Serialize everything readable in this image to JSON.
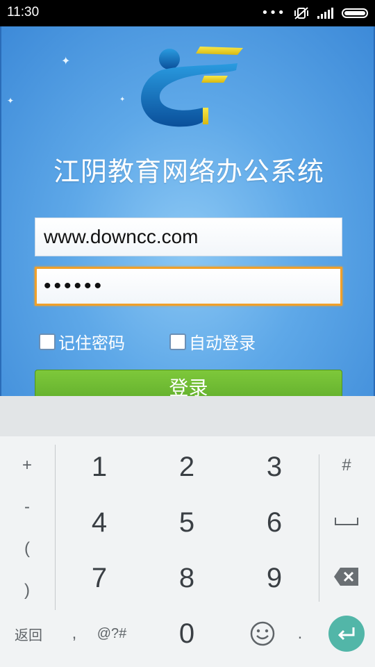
{
  "status_bar": {
    "time": "11:30",
    "icons": [
      "more-dots-icon",
      "mute-vibrate-icon",
      "signal-icon",
      "battery-icon"
    ]
  },
  "app": {
    "title": "江阴教育网络办公系统",
    "username_value": "www.downcc.com",
    "password_value": "••••••",
    "remember_password_label": "记住密码",
    "auto_login_label": "自动登录",
    "login_button_label": "登录"
  },
  "keyboard": {
    "left_keys": [
      "+",
      "-",
      "(",
      ")"
    ],
    "digits": [
      "1",
      "2",
      "3",
      "4",
      "5",
      "6",
      "7",
      "8",
      "9",
      "0"
    ],
    "right_keys": [
      "#",
      "space-icon",
      "backspace-icon"
    ],
    "bottom": {
      "back_label": "返回",
      "comma_label": ",",
      "symbols_label": "@?#",
      "period_label": ".",
      "emoji_icon": "emoji-icon",
      "enter_icon": "enter-icon"
    }
  },
  "colors": {
    "app_background": "#5ea8e8",
    "login_button": "#6cb832",
    "focus_border": "#f0a02a",
    "enter_key": "#52b6a8"
  }
}
